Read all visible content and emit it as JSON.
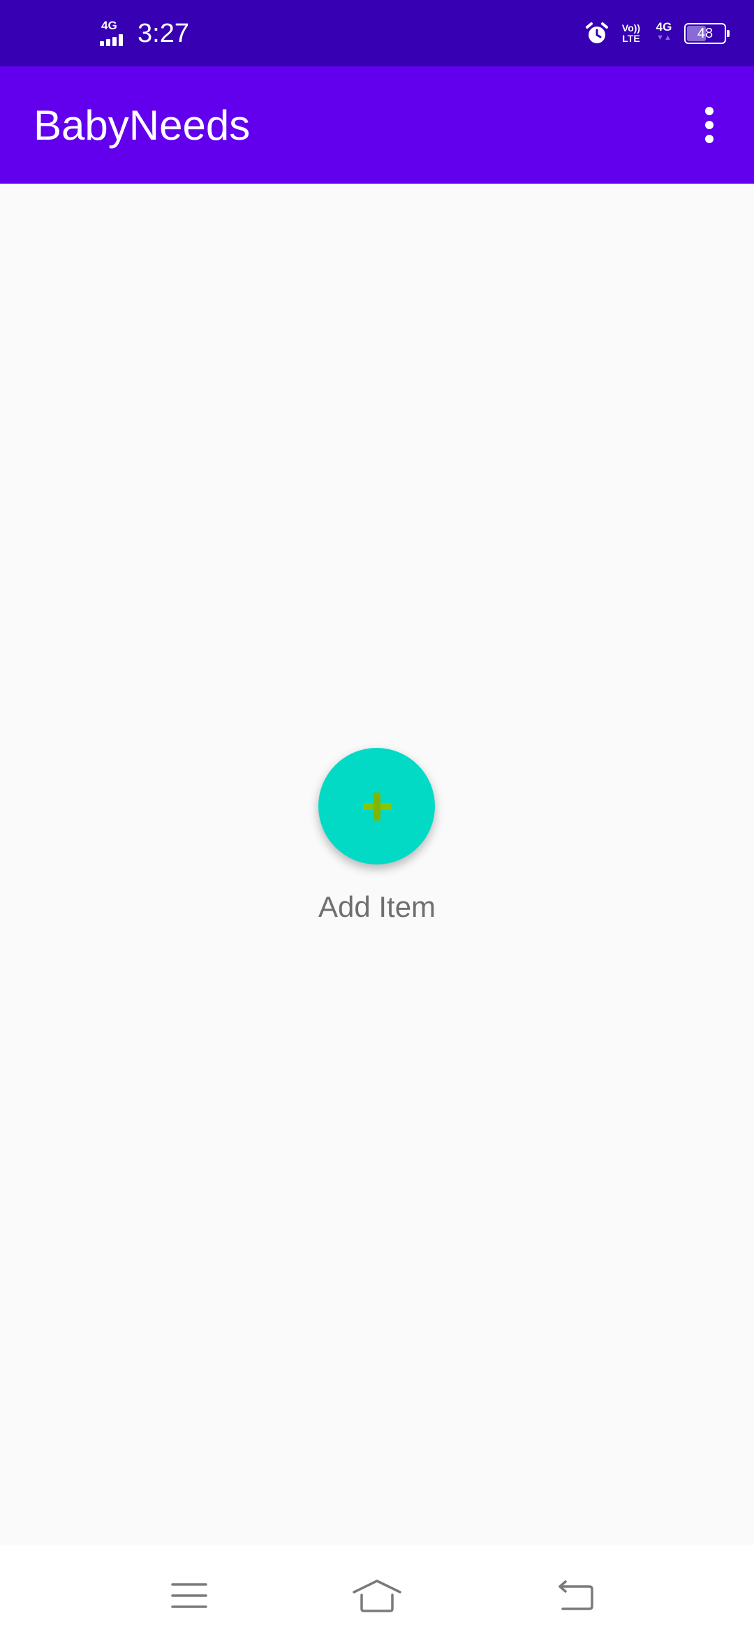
{
  "status_bar": {
    "network_label": "4G",
    "time": "3:27",
    "volte_line1": "Vo))",
    "volte_line2": "LTE",
    "data_label": "4G",
    "data_arrows": "▼▲",
    "battery_level": "48",
    "background_color": "#3700b3",
    "icons": [
      "signal-icon",
      "alarm-icon",
      "volte-icon",
      "data-4g-icon",
      "battery-icon"
    ]
  },
  "app_bar": {
    "title": "BabyNeeds",
    "background_color": "#6200ee",
    "overflow_icon": "more-vert-icon"
  },
  "main": {
    "fab_icon": "plus-icon",
    "fab_color": "#03dac6",
    "fab_icon_color": "#8bc400",
    "add_label": "Add Item"
  },
  "nav_bar": {
    "items": [
      {
        "name": "menu",
        "icon": "hamburger-icon"
      },
      {
        "name": "home",
        "icon": "home-icon"
      },
      {
        "name": "back",
        "icon": "back-icon"
      }
    ]
  }
}
